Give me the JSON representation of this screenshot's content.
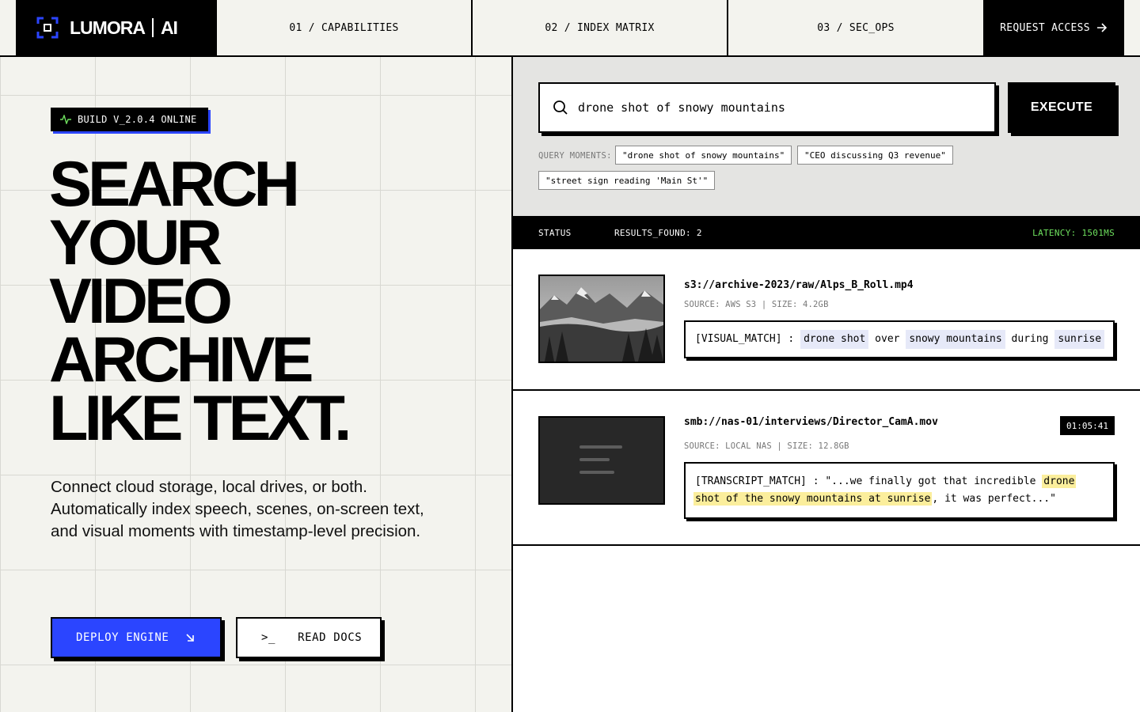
{
  "brand": {
    "name": "LUMORA",
    "suffix": "AI"
  },
  "nav": {
    "items": [
      "01 / CAPABILITIES",
      "02 / INDEX MATRIX",
      "03 / SEC_OPS"
    ],
    "cta": "REQUEST ACCESS"
  },
  "hero": {
    "badge": "BUILD V_2.0.4 ONLINE",
    "headline": [
      "SEARCH",
      "YOUR",
      "VIDEO",
      "ARCHIVE",
      "LIKE TEXT."
    ],
    "lead": "Connect cloud storage, local drives, or both. Automatically index speech, scenes, on-screen text, and visual moments with timestamp-level precision.",
    "primary_button": "DEPLOY ENGINE",
    "secondary_button": "READ DOCS",
    "secondary_prompt": ">_"
  },
  "search": {
    "value": "drone shot of snowy mountains",
    "execute": "EXECUTE",
    "moments_label": "QUERY MOMENTS:",
    "chips": [
      "\"drone shot of snowy mountains\"",
      "\"CEO discussing Q3 revenue\"",
      "\"street sign reading 'Main St'\""
    ]
  },
  "status": {
    "label": "STATUS",
    "results": "RESULTS_FOUND: 2",
    "latency": "LATENCY: 1501MS"
  },
  "results": [
    {
      "path": "s3://archive-2023/raw/Alps_B_Roll.mp4",
      "meta": "SOURCE: AWS S3 | SIZE: 4.2GB",
      "match_type": "[VISUAL_MATCH] :",
      "tokens": [
        "drone shot",
        "over",
        "snowy mountains",
        "during",
        "sunrise"
      ]
    },
    {
      "path": "smb://nas-01/interviews/Director_CamA.mov",
      "meta": "SOURCE: LOCAL NAS | SIZE: 12.8GB",
      "timecode": "01:05:41",
      "match_prefix": "[TRANSCRIPT_MATCH] : \"...we finally got that incredible",
      "highlight_1": "drone",
      "highlight_2": "shot of the snowy mountains at sunrise",
      "match_suffix": ", it was perfect...\""
    }
  ],
  "colors": {
    "accent": "#2b45ff",
    "latency": "#6ee05e",
    "highlight": "#fbee9c",
    "token": "#e6e9f8"
  }
}
